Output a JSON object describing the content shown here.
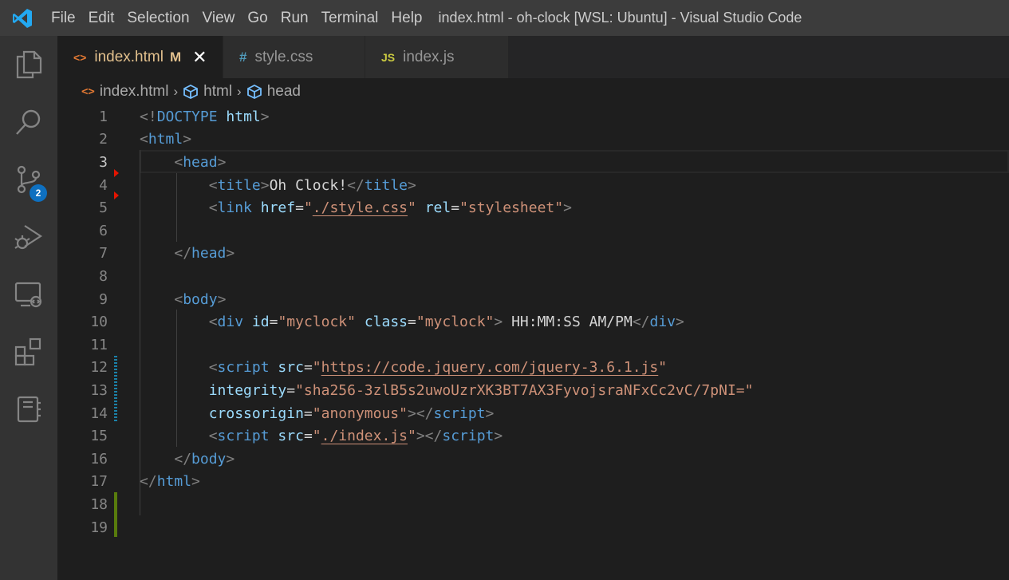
{
  "menu": [
    "File",
    "Edit",
    "Selection",
    "View",
    "Go",
    "Run",
    "Terminal",
    "Help"
  ],
  "window_title": "index.html - oh-clock [WSL: Ubuntu] - Visual Studio Code",
  "activity_badge": "2",
  "tabs": [
    {
      "label": "index.html",
      "icon": "<>",
      "modified": "M",
      "active": true
    },
    {
      "label": "style.css",
      "icon": "#",
      "active": false
    },
    {
      "label": "index.js",
      "icon": "JS",
      "active": false
    }
  ],
  "breadcrumb": [
    "index.html",
    "html",
    "head"
  ],
  "line_numbers": [
    "1",
    "2",
    "3",
    "4",
    "5",
    "6",
    "7",
    "8",
    "9",
    "10",
    "11",
    "12",
    "13",
    "14",
    "15",
    "16",
    "17",
    "18",
    "19"
  ],
  "code": {
    "doctype": "<!",
    "doctype_kw": "DOCTYPE",
    "doctype_html": "html",
    "tag_html": "html",
    "tag_head": "head",
    "tag_title": "title",
    "title_text": "Oh Clock!",
    "tag_link": "link",
    "attr_href": "href",
    "val_style": "./style.css",
    "attr_rel": "rel",
    "val_stylesheet": "\"stylesheet\"",
    "tag_body": "body",
    "tag_div": "div",
    "attr_id": "id",
    "val_myclock_id": "\"myclock\"",
    "attr_class": "class",
    "val_myclock_class": "\"myclock\"",
    "div_text": " HH:MM:SS AM/PM",
    "tag_script": "script",
    "attr_src": "src",
    "val_jquery": "https://code.jquery.com/jquery-3.6.1.js",
    "attr_integrity": "integrity",
    "val_integrity": "\"sha256-3zlB5s2uwoUzrXK3BT7AX3FyvojsraNFxCc2vC/7pNI=\"",
    "attr_crossorigin": "crossorigin",
    "val_anonymous": "\"anonymous\"",
    "val_indexjs": "./index.js"
  },
  "colors": {
    "accent_modified": "#e2c08d",
    "badge": "#0e70c0",
    "gutter_modified": "#1b81a8",
    "gutter_added": "#587c0c",
    "gutter_deleted": "#e51400"
  }
}
